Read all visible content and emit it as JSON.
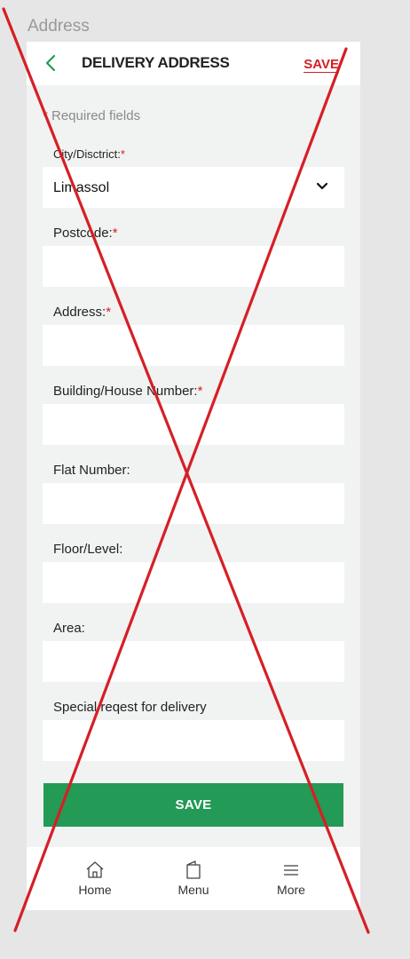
{
  "frame_title": "Address",
  "header": {
    "title": "DELIVERY ADDRESS",
    "save_label": "SAVE",
    "back_icon": "chevron-left-icon"
  },
  "required_note": {
    "star": "*",
    "text": " Required fields"
  },
  "fields": {
    "city": {
      "label": "City/Disctrict:",
      "value": "Limassol"
    },
    "postcode": {
      "label": "Postcode:",
      "value": ""
    },
    "address": {
      "label": "Address:",
      "value": ""
    },
    "building": {
      "label": "Building/House Number:",
      "value": ""
    },
    "flat": {
      "label": "Flat Number:",
      "value": ""
    },
    "floor": {
      "label": "Floor/Level:",
      "value": ""
    },
    "area": {
      "label": "Area:",
      "value": ""
    },
    "special": {
      "label": "Special reqest for delivery",
      "value": ""
    }
  },
  "required_marker": "*",
  "save_button": "SAVE",
  "tabbar": {
    "home": "Home",
    "menu": "Menu",
    "more": "More"
  },
  "colors": {
    "accent_red": "#d51f26",
    "save_green": "#239a56"
  }
}
